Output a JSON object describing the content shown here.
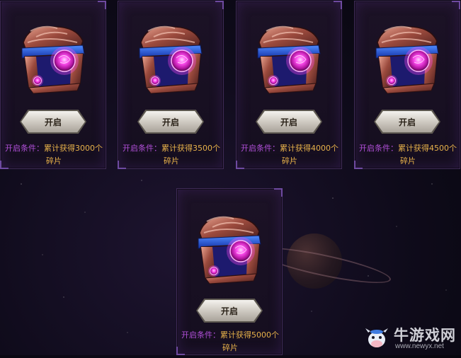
{
  "chests": [
    {
      "button_label": "开启",
      "condition_label": "开启条件：",
      "condition_value": "累计获得3000个",
      "condition_line2": "碎片"
    },
    {
      "button_label": "开启",
      "condition_label": "开启条件：",
      "condition_value": "累计获得3500个",
      "condition_line2": "碎片"
    },
    {
      "button_label": "开启",
      "condition_label": "开启条件：",
      "condition_value": "累计获得4000个",
      "condition_line2": "碎片"
    },
    {
      "button_label": "开启",
      "condition_label": "开启条件：",
      "condition_value": "累计获得4500个",
      "condition_line2": "碎片"
    },
    {
      "button_label": "开启",
      "condition_label": "开启条件：",
      "condition_value": "累计获得5000个",
      "condition_line2": "碎片"
    }
  ],
  "watermark": {
    "title": "牛游戏网",
    "url": "www.newyx.net",
    "icon": "cow-mascot-icon"
  },
  "colors": {
    "condition_label": "#b04fd8",
    "condition_value": "#e7b14a",
    "card_border": "#3f2b57"
  }
}
